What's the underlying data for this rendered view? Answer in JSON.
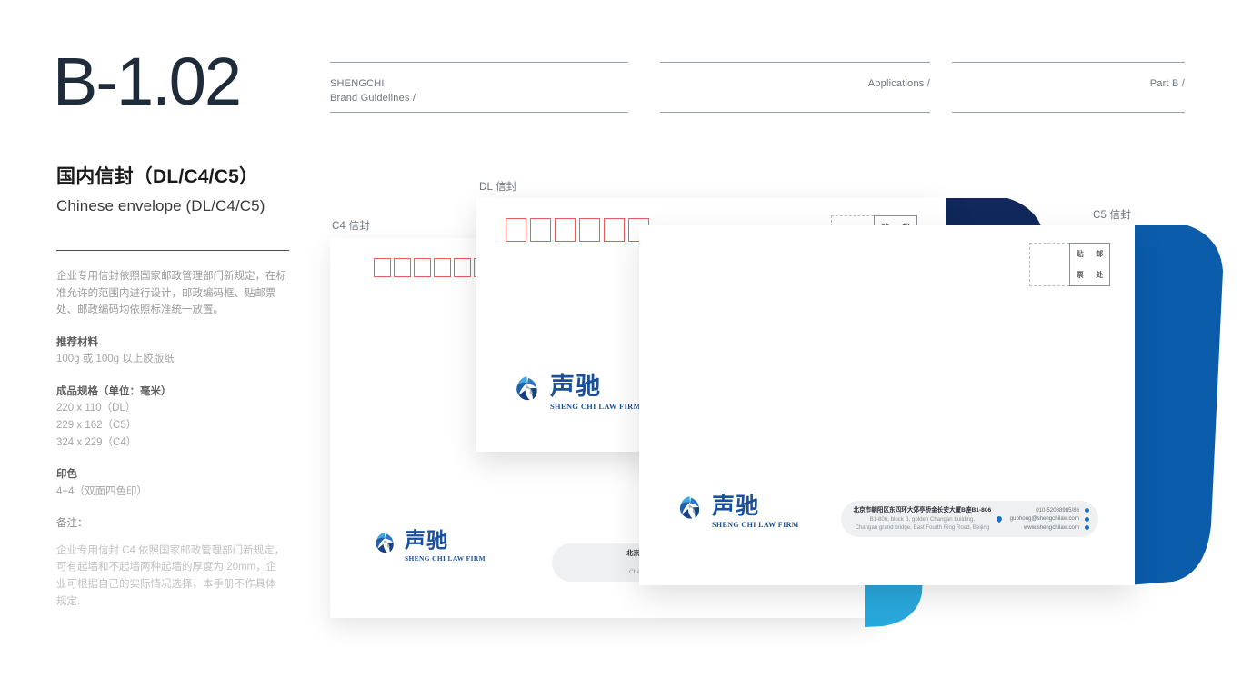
{
  "sidebar": {
    "code": "B-1.02",
    "title_cn": "国内信封（DL/C4/C5）",
    "title_en": "Chinese envelope (DL/C4/C5)",
    "intro": "企业专用信封依照国家邮政管理部门新规定，在标准允许的范围内进行设计，邮政编码框、贴邮票处、邮政编码均依照标准统一放置。",
    "material_head": "推荐材料",
    "material_val": "100g 或 100g 以上胶版纸",
    "size_head": "成品规格（单位：毫米）",
    "size_dl": "220 x 110（DL）",
    "size_c5": "229 x 162（C5）",
    "size_c4": "324 x 229（C4）",
    "ink_head": "印色",
    "ink_val": "4+4（双面四色印）",
    "note_head": "备注：",
    "note_body": "企业专用信封 C4 依照国家邮政管理部门新规定，可有起墙和不起墙两种起墙的厚度为 20mm，企业可根据自己的实际情况选择，本手册不作具体规定."
  },
  "header": {
    "brand_line1": "SHENGCHI",
    "brand_line2": "Brand Guidelines /",
    "section": "Applications /",
    "part": "Part B /"
  },
  "envelopes": {
    "c4_label": "C4 信封",
    "dl_label": "DL 信封",
    "c5_label": "C5 信封"
  },
  "stamp": {
    "c1": "贴",
    "c2": "邮",
    "c3": "票",
    "c4": "处"
  },
  "logo": {
    "cn": "声驰",
    "en": "SHENG CHI LAW FIRM"
  },
  "contact": {
    "address_cn": "北京市朝阳区东四环大郊亭桥金长安大厦B座B1-806",
    "address_en1": "B1-806, block B, golden Changan building,",
    "address_en2": "Changan grand bridge, East Fourth Ring Road, Beijing",
    "phone": "010-52088985/86",
    "email": "guohong@shengchilaw.com",
    "website": "www.shengchilaw.com"
  },
  "colors": {
    "navy_flap": "#10285c",
    "blue_flap": "#0b5cab",
    "cyan_flap": "#29a8dd",
    "logo_blue": "#1a4f9c",
    "postal_red": "#ef5a5a",
    "pill_bg": "#eff0f1"
  }
}
